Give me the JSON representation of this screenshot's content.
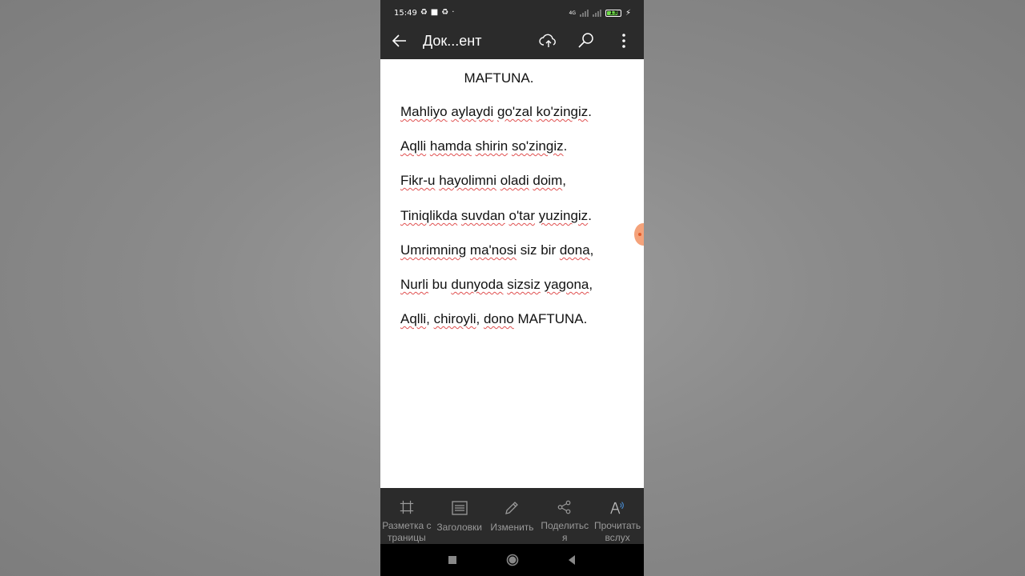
{
  "status_bar": {
    "time": "15:49",
    "network": "4G",
    "battery": "13"
  },
  "app_bar": {
    "title": "Док...ент"
  },
  "document": {
    "title": "MAFTUNA.",
    "lines": [
      [
        {
          "t": "Mahliyo",
          "s": true
        },
        {
          "t": " "
        },
        {
          "t": "aylaydi",
          "s": true
        },
        {
          "t": " "
        },
        {
          "t": "go'zal",
          "s": true
        },
        {
          "t": " "
        },
        {
          "t": "ko'zingiz",
          "s": true
        },
        {
          "t": "."
        }
      ],
      [
        {
          "t": "Aqlli",
          "s": true
        },
        {
          "t": " "
        },
        {
          "t": "hamda",
          "s": true
        },
        {
          "t": " "
        },
        {
          "t": "shirin",
          "s": true
        },
        {
          "t": " "
        },
        {
          "t": "so'zingiz",
          "s": true
        },
        {
          "t": "."
        }
      ],
      [
        {
          "t": "Fikr-u",
          "s": true
        },
        {
          "t": " "
        },
        {
          "t": "hayolimni",
          "s": true
        },
        {
          "t": " "
        },
        {
          "t": "oladi",
          "s": true
        },
        {
          "t": " "
        },
        {
          "t": "doim",
          "s": true
        },
        {
          "t": ","
        }
      ],
      [
        {
          "t": "Tiniqlikda",
          "s": true
        },
        {
          "t": " "
        },
        {
          "t": "suvdan",
          "s": true
        },
        {
          "t": " "
        },
        {
          "t": "o'tar",
          "s": true
        },
        {
          "t": " "
        },
        {
          "t": "yuzingiz",
          "s": true
        },
        {
          "t": "."
        }
      ],
      [
        {
          "t": "Umrimning",
          "s": true
        },
        {
          "t": " "
        },
        {
          "t": "ma'nosi",
          "s": true
        },
        {
          "t": " siz bir "
        },
        {
          "t": "dona",
          "s": true
        },
        {
          "t": ","
        }
      ],
      [
        {
          "t": "Nurli",
          "s": true
        },
        {
          "t": " bu "
        },
        {
          "t": "dunyoda",
          "s": true
        },
        {
          "t": " "
        },
        {
          "t": "sizsiz",
          "s": true
        },
        {
          "t": " "
        },
        {
          "t": "yagona",
          "s": true
        },
        {
          "t": ","
        }
      ],
      [
        {
          "t": "Aqlli",
          "s": true
        },
        {
          "t": ", "
        },
        {
          "t": "chiroyli",
          "s": true
        },
        {
          "t": ", "
        },
        {
          "t": "dono",
          "s": true
        },
        {
          "t": " MAFTUNA."
        }
      ]
    ]
  },
  "toolbar": {
    "items": [
      {
        "label": "Разметка страницы",
        "icon": "page-layout-icon"
      },
      {
        "label": "Заголовки",
        "icon": "headings-icon"
      },
      {
        "label": "Изменить",
        "icon": "pencil-icon"
      },
      {
        "label": "Поделиться",
        "icon": "share-icon"
      },
      {
        "label": "Прочитать вслух",
        "icon": "read-aloud-icon"
      }
    ]
  },
  "colors": {
    "bar_bg": "#2b2b2b",
    "doc_bg": "#ffffff",
    "spell_underline": "#e05050",
    "toolbar_text": "#9a9a9a"
  }
}
